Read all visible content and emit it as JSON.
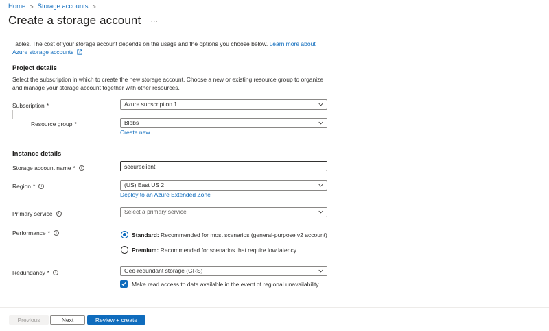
{
  "breadcrumb": {
    "home": "Home",
    "storage_accounts": "Storage accounts"
  },
  "page": {
    "title": "Create a storage account",
    "more": "···"
  },
  "intro": {
    "cutoff": "Tables. The cost of your storage account depends on the usage and the options you choose below.",
    "text": "Tables. The cost of your storage account depends on the usage and the options you choose below. ",
    "link": "Learn more about Azure storage accounts"
  },
  "project": {
    "heading": "Project details",
    "description": "Select the subscription in which to create the new storage account. Choose a new or existing resource group to organize and manage your storage account together with other resources.",
    "subscription_label": "Subscription",
    "subscription_value": "Azure subscription 1",
    "resource_group_label": "Resource group",
    "resource_group_value": "Blobs",
    "create_new": "Create new"
  },
  "instance": {
    "heading": "Instance details",
    "name_label": "Storage account name",
    "name_value": "secureclient",
    "region_label": "Region",
    "region_value": "(US) East US 2",
    "edge_zone_link": "Deploy to an Azure Extended Zone",
    "primary_service_label": "Primary service",
    "primary_service_placeholder": "Select a primary service",
    "performance_label": "Performance",
    "perf_standard_title": "Standard:",
    "perf_standard_desc": " Recommended for most scenarios (general-purpose v2 account)",
    "perf_premium_title": "Premium:",
    "perf_premium_desc": " Recommended for scenarios that require low latency.",
    "redundancy_label": "Redundancy",
    "redundancy_value": "Geo-redundant storage (GRS)",
    "read_access_label": "Make read access to data available in the event of regional unavailability."
  },
  "footer": {
    "previous": "Previous",
    "next": "Next",
    "review": "Review + create"
  },
  "colors": {
    "accent": "#0f6cbd",
    "text": "#323130",
    "border": "#8a8886"
  }
}
